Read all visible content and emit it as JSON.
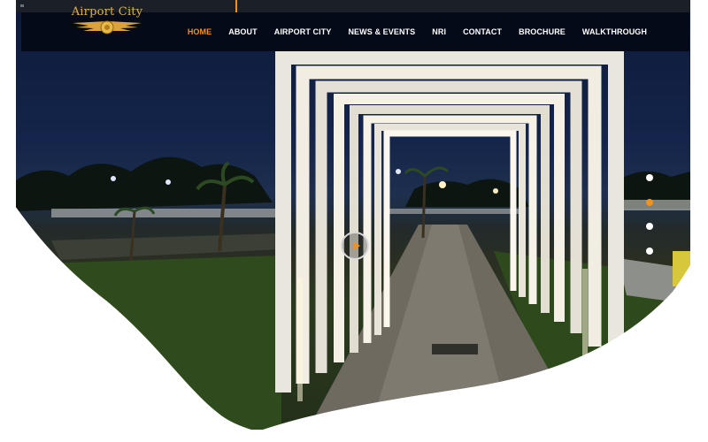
{
  "nav": {
    "logo_text": "Airport City",
    "items": [
      {
        "label": "HOME",
        "active": true
      },
      {
        "label": "ABOUT",
        "active": false
      },
      {
        "label": "AIRPORT CITY",
        "active": false
      },
      {
        "label": "NEWS & EVENTS",
        "active": false
      },
      {
        "label": "NRI",
        "active": false
      },
      {
        "label": "CONTACT",
        "active": false
      },
      {
        "label": "BROCHURE",
        "active": false
      },
      {
        "label": "WALKTHROUGH",
        "active": false
      }
    ]
  },
  "hero": {
    "image": "night-walkway-arches",
    "play_icon": "play-icon"
  },
  "slider": {
    "slide_count": 4,
    "active_index": 1
  },
  "colors": {
    "accent": "#f0931e",
    "nav_bg": "#050a18",
    "logo_gold": "#e3b14a"
  }
}
